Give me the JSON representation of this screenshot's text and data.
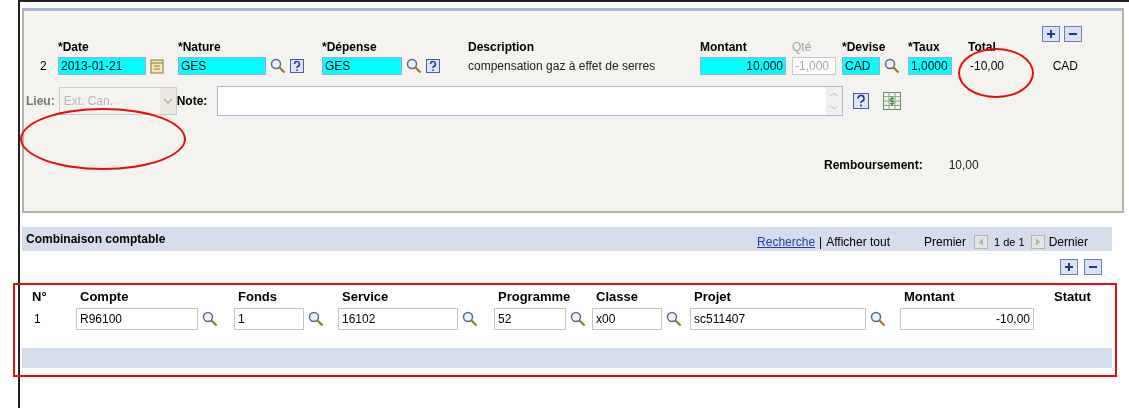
{
  "expense": {
    "row_number": "2",
    "headers": [
      {
        "label": "*Date",
        "disabled": false
      },
      {
        "label": "*Nature",
        "disabled": false
      },
      {
        "label": "*Dépense",
        "disabled": false
      },
      {
        "label": "Description",
        "disabled": false
      },
      {
        "label": "Montant",
        "disabled": false
      },
      {
        "label": "Qté",
        "disabled": true
      },
      {
        "label": "*Devise",
        "disabled": false
      },
      {
        "label": "*Taux",
        "disabled": false
      },
      {
        "label": "Total",
        "disabled": false
      }
    ],
    "date": {
      "value": "2013-01-21",
      "required": true
    },
    "nature": {
      "value": "GES",
      "required": true
    },
    "depense": {
      "value": "GES",
      "required": true
    },
    "description": "compensation gaz à effet de serres",
    "montant": {
      "value": "10,000",
      "required": true
    },
    "qte": {
      "value": "-1,000",
      "disabled": true
    },
    "devise": {
      "value": "CAD",
      "required": true
    },
    "taux": {
      "value": "1,0000",
      "required": true
    },
    "total": "-10,00",
    "currency": "CAD",
    "lieu": {
      "label": "Lieu:",
      "value": "Ext. Can.",
      "disabled": true
    },
    "note": {
      "label": "Note:"
    }
  },
  "remboursement": {
    "label": "Remboursement:",
    "value": "10,00"
  },
  "combinaison": {
    "title": "Combinaison comptable",
    "search_link": "Recherche",
    "separator": "|",
    "show_all": "Afficher tout",
    "pager": {
      "first": "Premier",
      "position": "1 de 1",
      "last": "Dernier"
    },
    "columns": [
      "N°",
      "Compte",
      "Fonds",
      "Service",
      "Programme",
      "Classe",
      "Projet",
      "Montant",
      "Statut"
    ],
    "rows": [
      {
        "number": "1",
        "compte": "R96100",
        "fonds": "1",
        "service": "16102",
        "programme": "52",
        "classe": "x00",
        "projet": "sc511407",
        "montant": "-10,00"
      }
    ]
  },
  "annotations": [
    {
      "kind": "ellipse"
    },
    {
      "kind": "ellipse"
    },
    {
      "kind": "rectangle"
    }
  ]
}
